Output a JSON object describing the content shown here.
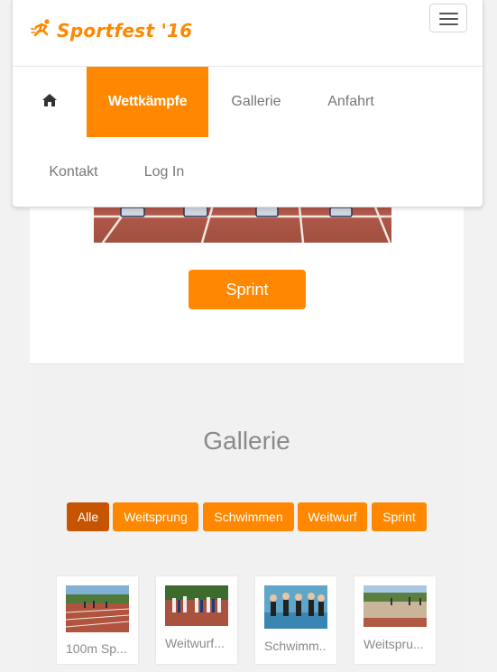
{
  "brand": {
    "name": "Sportfest '16",
    "logo_icon": "runner-icon"
  },
  "colors": {
    "accent": "#ff8800",
    "accent_active": "#c65400"
  },
  "nav": {
    "home_icon": "home-icon",
    "items": [
      {
        "label": "Wettkämpfe",
        "active": true
      },
      {
        "label": "Gallerie",
        "active": false
      },
      {
        "label": "Anfahrt",
        "active": false
      },
      {
        "label": "Kontakt",
        "active": false
      },
      {
        "label": "Log In",
        "active": false
      }
    ]
  },
  "hero": {
    "button_label": "Sprint"
  },
  "gallery": {
    "title": "Gallerie",
    "filters": [
      {
        "label": "Alle",
        "active": true
      },
      {
        "label": "Weitsprung",
        "active": false
      },
      {
        "label": "Schwimmen",
        "active": false
      },
      {
        "label": "Weitwurf",
        "active": false
      },
      {
        "label": "Sprint",
        "active": false
      }
    ],
    "items": [
      {
        "caption": "100m Sp..."
      },
      {
        "caption": "Weitwurf..."
      },
      {
        "caption": "Schwimm.."
      },
      {
        "caption": "Weitspru..."
      }
    ]
  }
}
